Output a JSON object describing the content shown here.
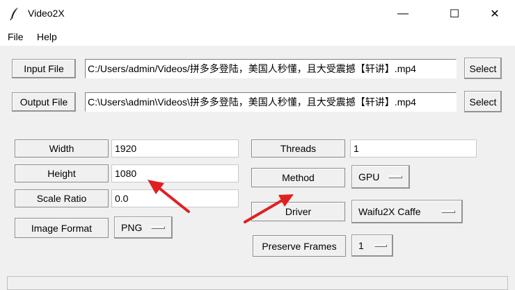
{
  "window": {
    "title": "Video2X",
    "controls": {
      "minimize": "—",
      "maximize": "☐",
      "close": "✕"
    }
  },
  "menu": {
    "items": [
      "File",
      "Help"
    ]
  },
  "input": {
    "button_label": "Input File",
    "path": "C:/Users/admin/Videos/拼多多登陆，美国人秒懂，且大受震撼【轩讲】.mp4",
    "select_label": "Select"
  },
  "output": {
    "button_label": "Output File",
    "path": "C:\\Users\\admin\\Videos\\拼多多登陆，美国人秒懂，且大受震撼【轩讲】.mp4",
    "select_label": "Select"
  },
  "settings": {
    "width": {
      "label": "Width",
      "value": "1920"
    },
    "height": {
      "label": "Height",
      "value": "1080"
    },
    "scale_ratio": {
      "label": "Scale Ratio",
      "value": "0.0"
    },
    "image_format": {
      "label": "Image Format",
      "value": "PNG"
    },
    "threads": {
      "label": "Threads",
      "value": "1"
    },
    "method": {
      "label": "Method",
      "value": "GPU"
    },
    "driver": {
      "label": "Driver",
      "value": "Waifu2X Caffe"
    },
    "preserve_frames": {
      "label": "Preserve Frames",
      "value": "1"
    }
  },
  "colors": {
    "background": "#f0f0f0",
    "annotation_arrow": "#e02020"
  },
  "icons": {
    "app": "feather-icon"
  }
}
